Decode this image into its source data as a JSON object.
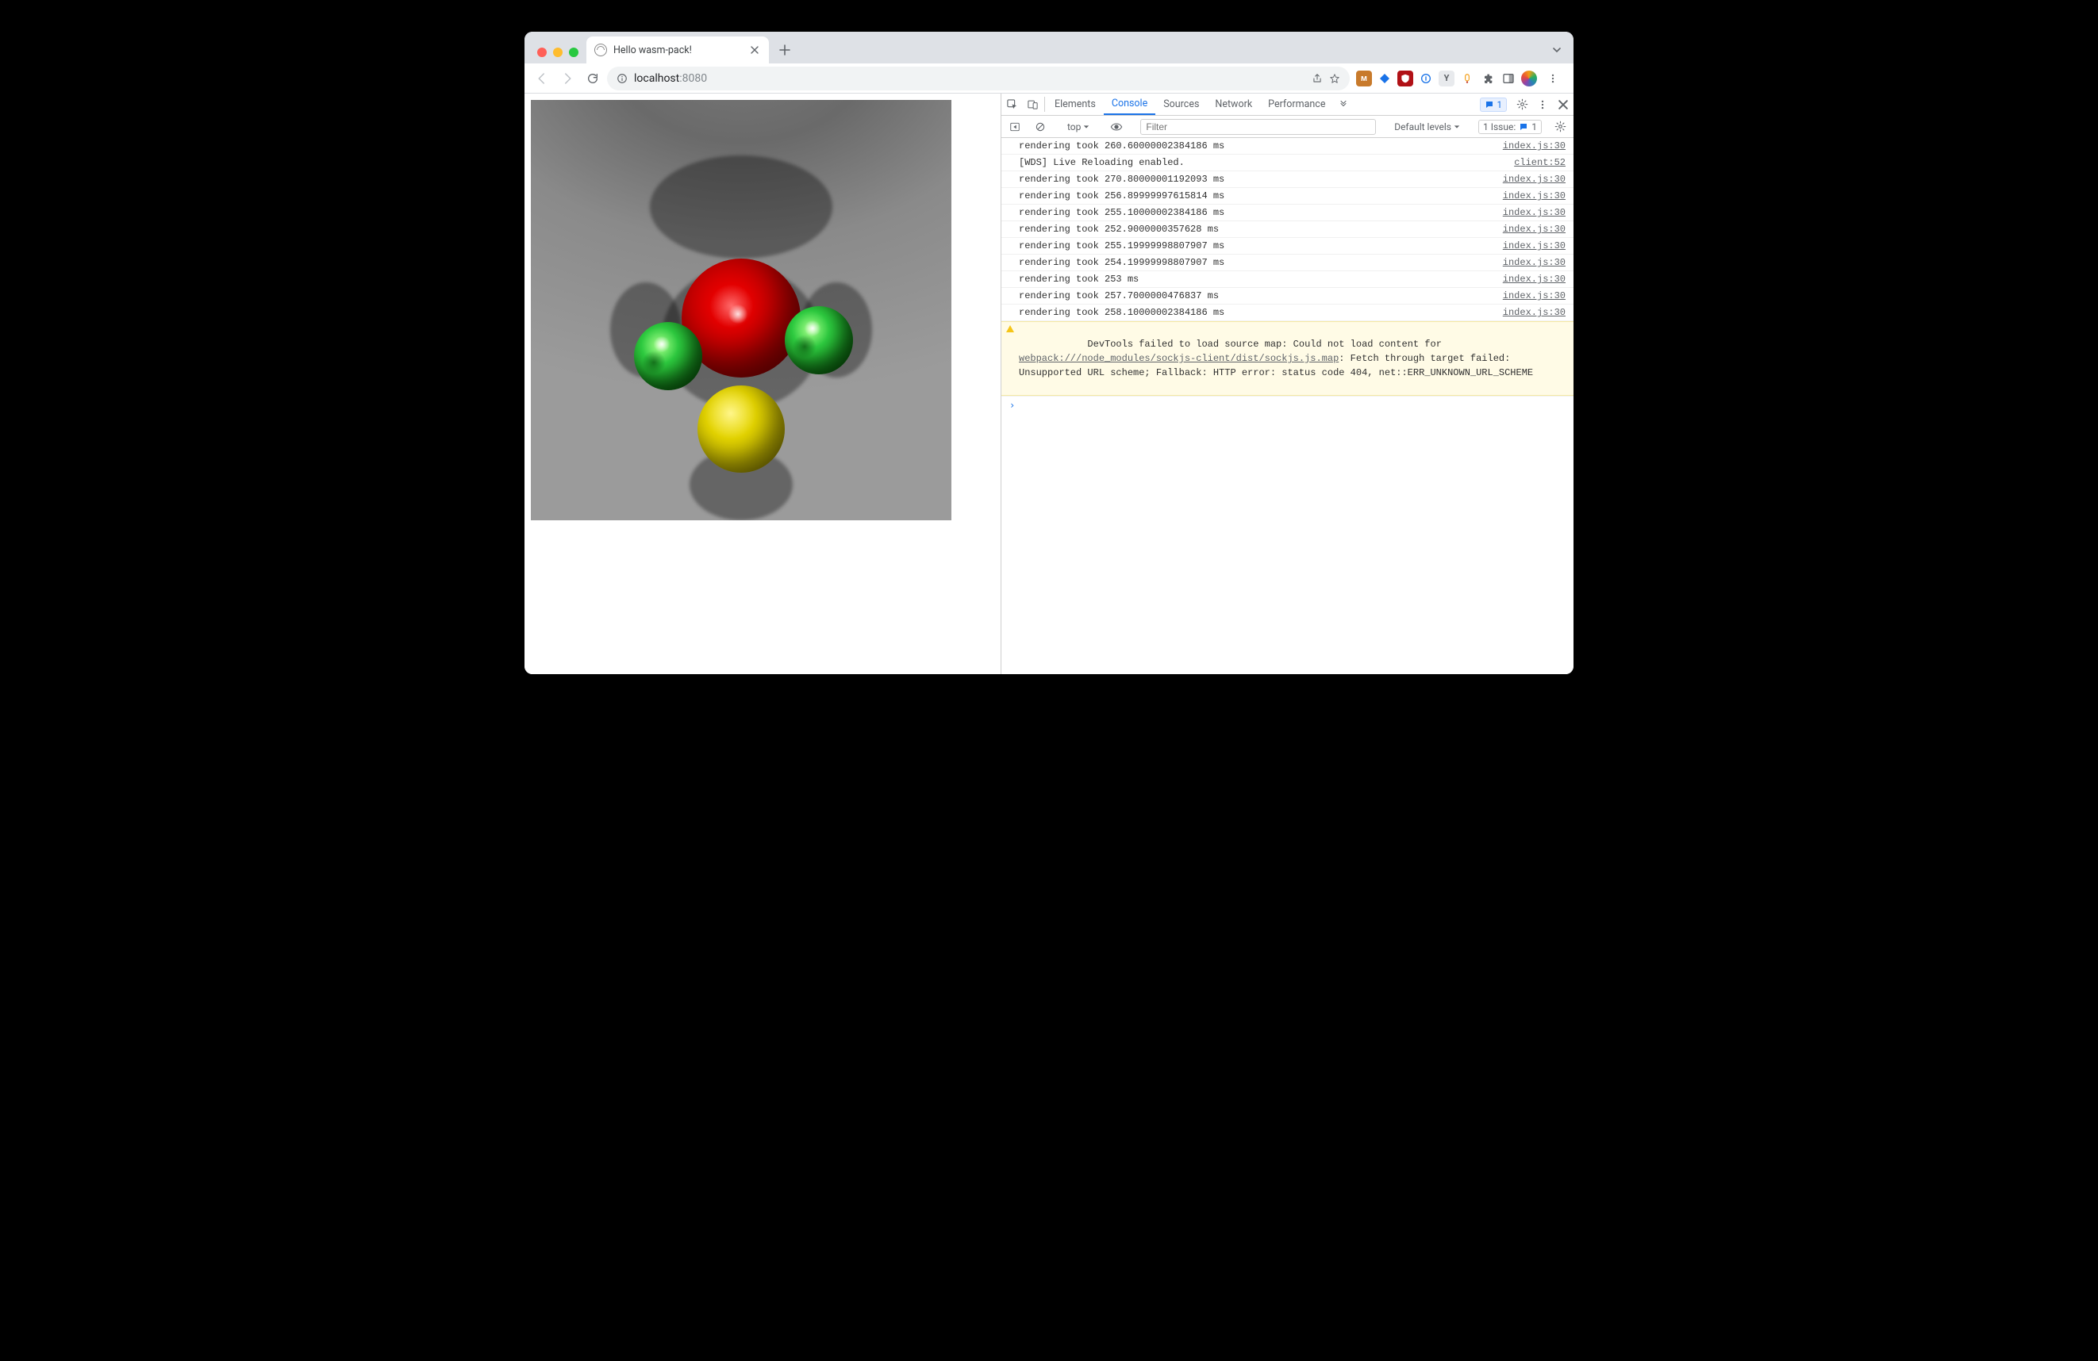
{
  "window": {
    "tab_title": "Hello wasm-pack!"
  },
  "toolbar": {
    "url_host": "localhost",
    "url_port": ":8080"
  },
  "devtools": {
    "tabs": [
      "Elements",
      "Console",
      "Sources",
      "Network",
      "Performance"
    ],
    "active_tab": "Console",
    "pill_count": "1",
    "filter_placeholder": "Filter",
    "context_label": "top",
    "levels_label": "Default levels",
    "issues_label": "1 Issue:",
    "issues_count": "1"
  },
  "console": {
    "rows": [
      {
        "msg": "rendering took 260.60000002384186 ms",
        "src": "index.js:30"
      },
      {
        "msg": "[WDS] Live Reloading enabled.",
        "src": "client:52"
      },
      {
        "msg": "rendering took 270.80000001192093 ms",
        "src": "index.js:30"
      },
      {
        "msg": "rendering took 256.89999997615814 ms",
        "src": "index.js:30"
      },
      {
        "msg": "rendering took 255.10000002384186 ms",
        "src": "index.js:30"
      },
      {
        "msg": "rendering took 252.9000000357628 ms",
        "src": "index.js:30"
      },
      {
        "msg": "rendering took 255.19999998807907 ms",
        "src": "index.js:30"
      },
      {
        "msg": "rendering took 254.19999998807907 ms",
        "src": "index.js:30"
      },
      {
        "msg": "rendering took 253 ms",
        "src": "index.js:30"
      },
      {
        "msg": "rendering took 257.7000000476837 ms",
        "src": "index.js:30"
      },
      {
        "msg": "rendering took 258.10000002384186 ms",
        "src": "index.js:30"
      }
    ],
    "warning": {
      "pre": "DevTools failed to load source map: Could not load content for ",
      "link": "webpack:///node_modules/sockjs-client/dist/sockjs.js.map",
      "post": ": Fetch through target failed: Unsupported URL scheme; Fallback: HTTP error: status code 404, net::ERR_UNKNOWN_URL_SCHEME"
    },
    "prompt": "›"
  }
}
